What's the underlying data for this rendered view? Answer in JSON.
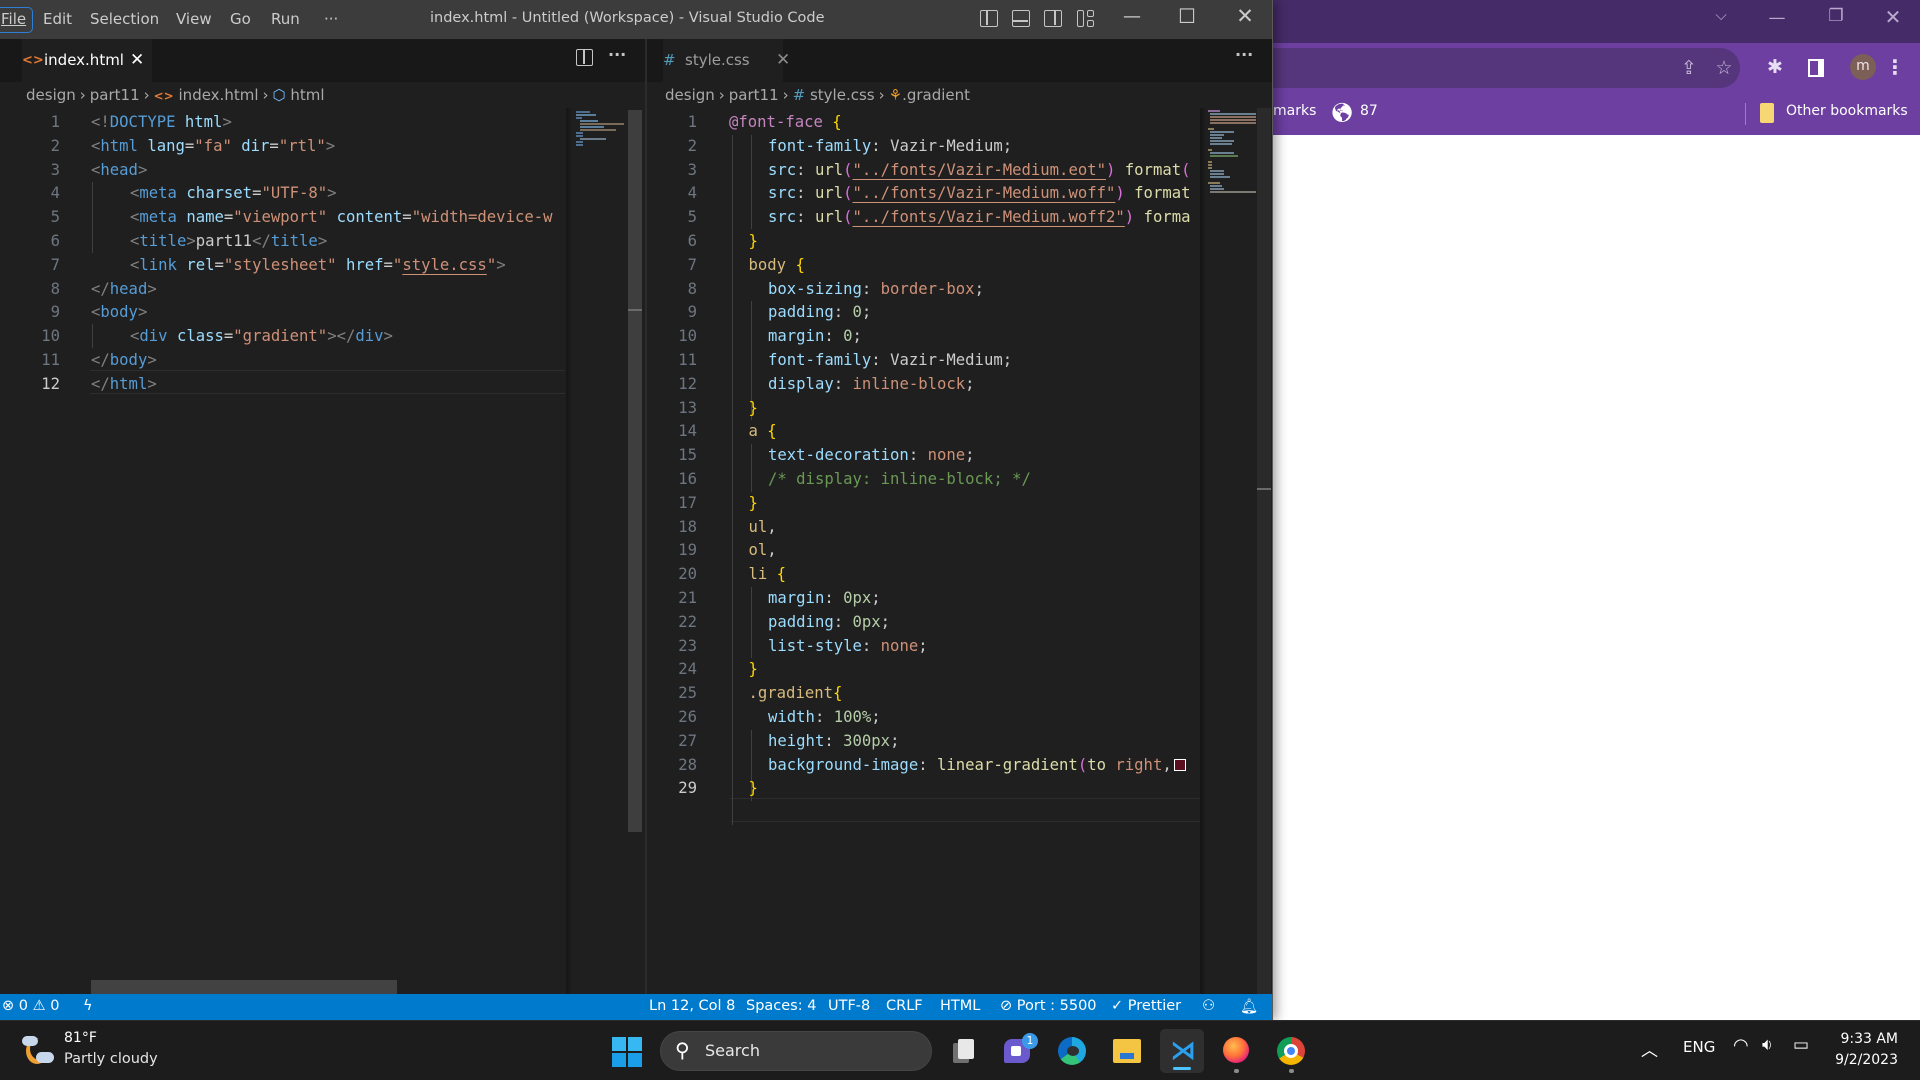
{
  "chrome": {
    "window_controls": [
      "chevron-down",
      "minimize",
      "restore",
      "close"
    ],
    "bookmarks_partial_label": "marks",
    "bookmark_globe_label": "87",
    "other_bookmarks_label": "Other bookmarks",
    "profile_initial": "m",
    "colors": {
      "frame": "#452b68",
      "toolbar": "#6c3fa0",
      "omnibox": "#55357c"
    }
  },
  "vscode": {
    "title": "index.html - Untitled (Workspace) - Visual Studio Code",
    "menu": [
      "File",
      "Edit",
      "Selection",
      "View",
      "Go",
      "Run",
      "···"
    ],
    "left_group": {
      "tab": {
        "label": "index.html",
        "icon": "html-file-icon",
        "close": "✕"
      },
      "breadcrumb": [
        "design",
        "part11",
        "index.html",
        "html"
      ],
      "lines": [
        {
          "n": "1"
        },
        {
          "n": "2"
        },
        {
          "n": "3"
        },
        {
          "n": "4"
        },
        {
          "n": "5"
        },
        {
          "n": "6"
        },
        {
          "n": "7"
        },
        {
          "n": "8"
        },
        {
          "n": "9"
        },
        {
          "n": "10"
        },
        {
          "n": "11"
        },
        {
          "n": "12"
        }
      ],
      "code": {
        "l1": [
          "<!",
          "DOCTYPE",
          " html",
          ">"
        ],
        "l2": [
          "<",
          "html",
          " lang",
          "=",
          "\"fa\"",
          " dir",
          "=",
          "\"rtl\"",
          ">"
        ],
        "l3": [
          "<",
          "head",
          ">"
        ],
        "l4": [
          "<",
          "meta",
          " charset",
          "=",
          "\"UTF-8\"",
          ">"
        ],
        "l5": [
          "<",
          "meta",
          " name",
          "=",
          "\"viewport\"",
          " content",
          "=",
          "\"width=device-w"
        ],
        "l6": [
          "<",
          "title",
          ">",
          "part11",
          "</",
          "title",
          ">"
        ],
        "l7": [
          "<",
          "link",
          " rel",
          "=",
          "\"stylesheet\"",
          " href",
          "=",
          "\"",
          "style.css",
          "\"",
          ">"
        ],
        "l8": [
          "</",
          "head",
          ">"
        ],
        "l9": [
          "<",
          "body",
          ">"
        ],
        "l10": [
          "<",
          "div",
          " class",
          "=",
          "\"gradient\"",
          "></",
          "div",
          ">"
        ],
        "l11": [
          "</",
          "body",
          ">"
        ],
        "l12": [
          "</",
          "html",
          ">"
        ]
      }
    },
    "right_group": {
      "tab": {
        "label": "style.css",
        "icon": "css-file-icon",
        "close": "✕"
      },
      "breadcrumb": [
        "design",
        "part11",
        "style.css",
        ".gradient"
      ],
      "code": {
        "l1": [
          "@font-face",
          " {"
        ],
        "l2": [
          "font-family",
          ": ",
          "Vazir-Medium",
          ";"
        ],
        "l3": [
          "src",
          ": ",
          "url",
          "(",
          "\"../fonts/Vazir-Medium.eot\"",
          ")",
          " format",
          "("
        ],
        "l4": [
          "src",
          ": ",
          "url",
          "(",
          "\"../fonts/Vazir-Medium.woff\"",
          ")",
          " format"
        ],
        "l5": [
          "src",
          ": ",
          "url",
          "(",
          "\"../fonts/Vazir-Medium.woff2\"",
          ")",
          " forma"
        ],
        "l6": [
          "}"
        ],
        "l7": [
          "body",
          " {"
        ],
        "l8": [
          "box-sizing",
          ": ",
          "border-box",
          ";"
        ],
        "l9": [
          "padding",
          ": ",
          "0",
          ";"
        ],
        "l10": [
          "margin",
          ": ",
          "0",
          ";"
        ],
        "l11": [
          "font-family",
          ": ",
          "Vazir-Medium",
          ";"
        ],
        "l12": [
          "display",
          ": ",
          "inline-block",
          ";"
        ],
        "l13": [
          "}"
        ],
        "l14": [
          "a",
          " {"
        ],
        "l15": [
          "text-decoration",
          ": ",
          "none",
          ";"
        ],
        "l16": [
          "/* display: inline-block; */"
        ],
        "l17": [
          "}"
        ],
        "l18": [
          "ul",
          ","
        ],
        "l19": [
          "ol",
          ","
        ],
        "l20": [
          "li",
          " {"
        ],
        "l21": [
          "margin",
          ": ",
          "0px",
          ";"
        ],
        "l22": [
          "padding",
          ": ",
          "0px",
          ";"
        ],
        "l23": [
          "list-style",
          ": ",
          "none",
          ";"
        ],
        "l24": [
          "}"
        ],
        "l25": [
          ".gradient",
          "{"
        ],
        "l26": [
          "width",
          ": ",
          "100%",
          ";"
        ],
        "l27": [
          "height",
          ": ",
          "300px",
          ";"
        ],
        "l28": [
          "background-image",
          ": ",
          "linear-gradient",
          "(",
          "to ",
          "right",
          ","
        ],
        "l29": [
          "}"
        ]
      },
      "swatch_color": "#5a0f1e",
      "line_count": 29,
      "current_line": 29
    },
    "left_current_line": 12,
    "status": {
      "errors": "0",
      "warnings": "0",
      "position": "Ln 12, Col 8",
      "spaces": "Spaces: 4",
      "encoding": "UTF-8",
      "eol": "CRLF",
      "language": "HTML",
      "port": "Port : 5500",
      "prettier": "Prettier"
    }
  },
  "taskbar": {
    "weather_temp": "81°F",
    "weather_condition": "Partly cloudy",
    "search_label": "Search",
    "chat_badge": "1",
    "apps": [
      "task-view",
      "teams-chat",
      "edge",
      "file-explorer",
      "vscode",
      "firefox",
      "chrome"
    ],
    "language": "ENG",
    "time": "9:33 AM",
    "date": "9/2/2023"
  },
  "colors": {
    "statusbar": "#007acc",
    "editor_bg": "#1f1f1f",
    "titlebar": "#3c3c3c"
  }
}
